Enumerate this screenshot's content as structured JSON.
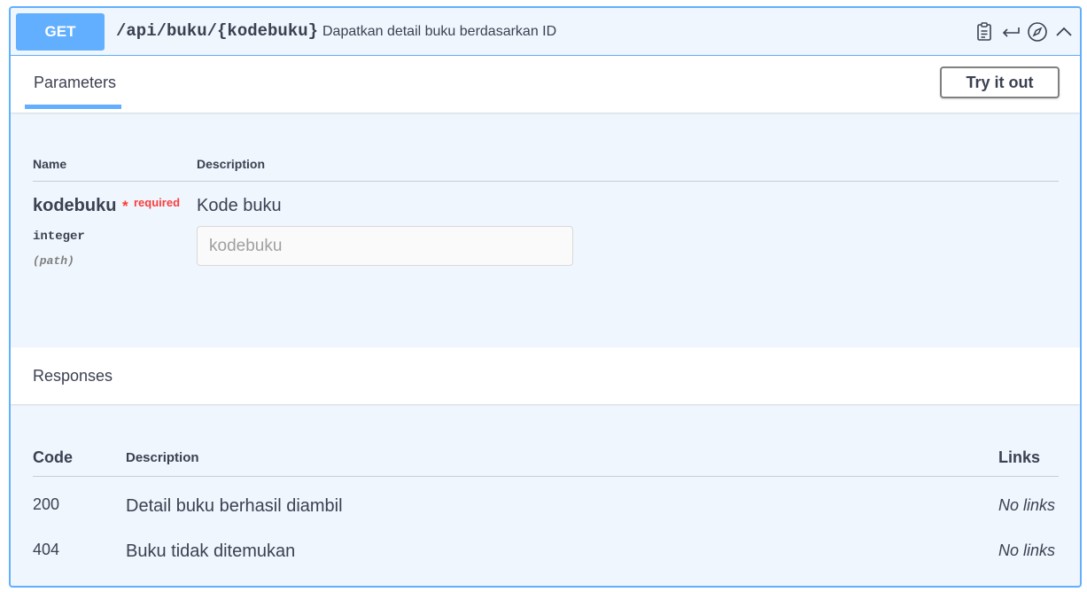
{
  "summary": {
    "method": "GET",
    "path": "/api/buku/{kodebuku}",
    "description": "Dapatkan detail buku berdasarkan ID",
    "icons": [
      "clipboard-icon",
      "return-arrow-icon",
      "compass-icon",
      "chevron-up-icon"
    ]
  },
  "tabs": {
    "parameters_label": "Parameters",
    "try_it_out_label": "Try it out"
  },
  "parameters": {
    "headers": {
      "name": "Name",
      "description": "Description"
    },
    "items": [
      {
        "name": "kodebuku",
        "required_star": "*",
        "required_label": "required",
        "type": "integer",
        "in": "(path)",
        "description": "Kode buku",
        "input_placeholder": "kodebuku",
        "input_value": ""
      }
    ]
  },
  "responses": {
    "title": "Responses",
    "headers": {
      "code": "Code",
      "description": "Description",
      "links": "Links"
    },
    "rows": [
      {
        "code": "200",
        "description": "Detail buku berhasil diambil",
        "links": "No links"
      },
      {
        "code": "404",
        "description": "Buku tidak ditemukan",
        "links": "No links"
      }
    ]
  },
  "colors": {
    "accent": "#61affe",
    "block_background": "#eff6fd",
    "required": "#f93e3e"
  }
}
